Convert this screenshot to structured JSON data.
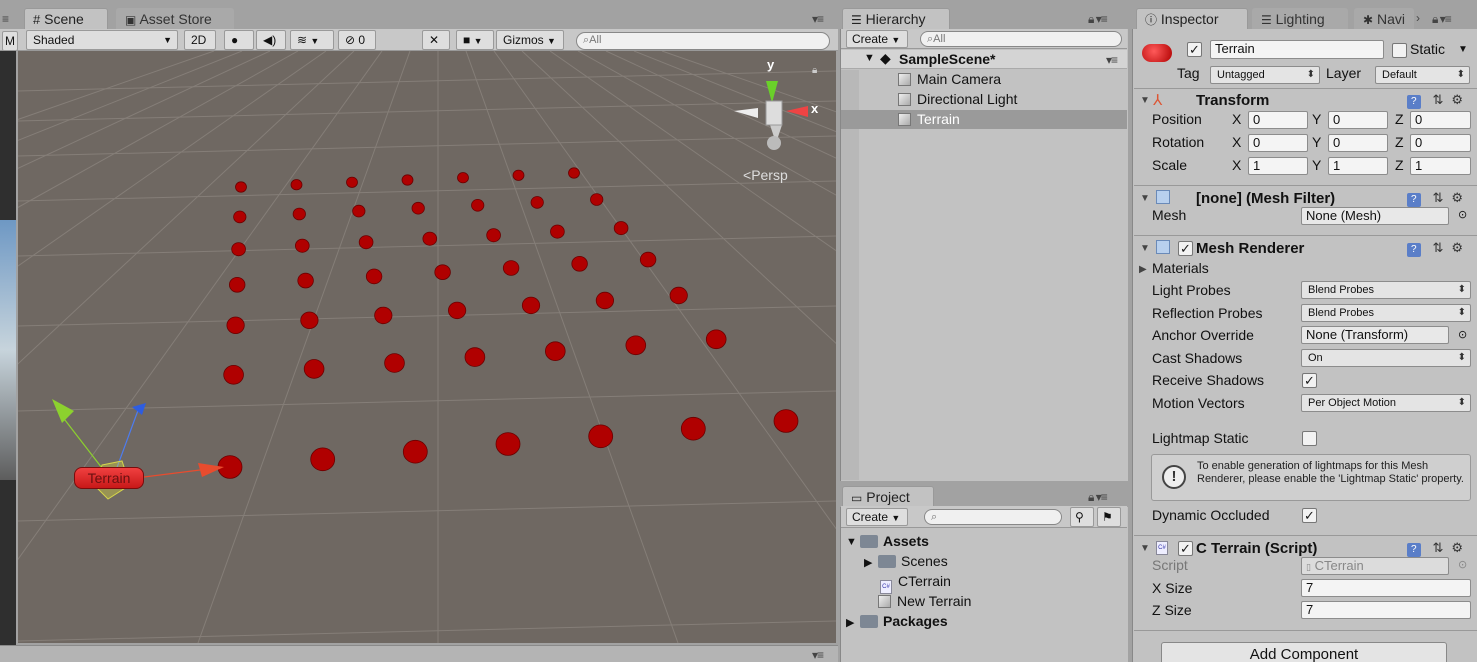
{
  "scene_tabs": {
    "scene": "Scene",
    "asset_store": "Asset Store"
  },
  "scene_toolbar": {
    "shading": "Shaded",
    "mode_2d": "2D",
    "fx_count": "0",
    "gizmos": "Gizmos",
    "search_placeholder": "All",
    "left_edge_btn": "M"
  },
  "viewport": {
    "bg_color": "#6f6862",
    "sphere_color": "#b00000",
    "persp_label": "Persp",
    "axis_y": "y",
    "axis_x": "x",
    "selected_label": "Terrain",
    "grid_shape": [
      7,
      7
    ]
  },
  "hierarchy": {
    "tab": "Hierarchy",
    "create": "Create",
    "search_placeholder": "All",
    "scene_name": "SampleScene*",
    "items": [
      "Main Camera",
      "Directional Light",
      "Terrain"
    ],
    "selected_index": 2
  },
  "project": {
    "tab": "Project",
    "create": "Create",
    "assets": "Assets",
    "items": [
      "Scenes",
      "CTerrain",
      "New Terrain"
    ],
    "packages": "Packages"
  },
  "inspector": {
    "tabs": [
      "Inspector",
      "Lighting",
      "Navi"
    ],
    "object_name": "Terrain",
    "static_label": "Static",
    "tag_label": "Tag",
    "tag_value": "Untagged",
    "layer_label": "Layer",
    "layer_value": "Default",
    "transform": {
      "title": "Transform",
      "rows": [
        {
          "label": "Position",
          "x": "0",
          "y": "0",
          "z": "0"
        },
        {
          "label": "Rotation",
          "x": "0",
          "y": "0",
          "z": "0"
        },
        {
          "label": "Scale",
          "x": "1",
          "y": "1",
          "z": "1"
        }
      ],
      "axis_x": "X",
      "axis_y": "Y",
      "axis_z": "Z"
    },
    "mesh_filter": {
      "title": "[none] (Mesh Filter)",
      "mesh_label": "Mesh",
      "mesh_value": "None (Mesh)"
    },
    "mesh_renderer": {
      "title": "Mesh Renderer",
      "materials": "Materials",
      "light_probes_label": "Light Probes",
      "light_probes": "Blend Probes",
      "reflection_probes_label": "Reflection Probes",
      "reflection_probes": "Blend Probes",
      "anchor_override_label": "Anchor Override",
      "anchor_override": "None (Transform)",
      "cast_shadows_label": "Cast Shadows",
      "cast_shadows": "On",
      "receive_shadows_label": "Receive Shadows",
      "motion_vectors_label": "Motion Vectors",
      "motion_vectors": "Per Object Motion",
      "lightmap_static_label": "Lightmap Static",
      "info": "To enable generation of lightmaps for this Mesh Renderer, please enable the 'Lightmap Static' property.",
      "dynamic_occluded_label": "Dynamic Occluded"
    },
    "script_comp": {
      "title": "C Terrain (Script)",
      "script_label": "Script",
      "script_value": "CTerrain",
      "x_size_label": "X Size",
      "x_size": "7",
      "z_size_label": "Z Size",
      "z_size": "7"
    },
    "add_component": "Add Component"
  }
}
